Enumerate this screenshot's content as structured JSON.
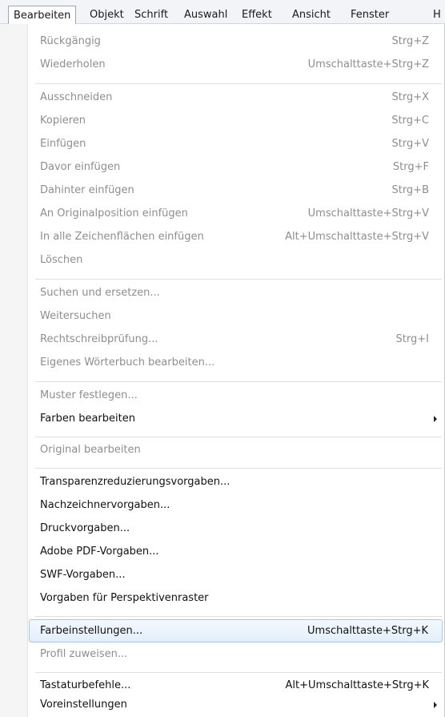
{
  "menubar": {
    "items": [
      "Bearbeiten",
      "Objekt",
      "Schrift",
      "Auswahl",
      "Effekt",
      "Ansicht",
      "Fenster",
      "H"
    ]
  },
  "menu": {
    "items": [
      {
        "label": "Rückgängig",
        "shortcut": "Strg+Z",
        "state": "disabled"
      },
      {
        "label": "Wiederholen",
        "shortcut": "Umschalttaste+Strg+Z",
        "state": "disabled"
      },
      {
        "label": "Ausschneiden",
        "shortcut": "Strg+X",
        "state": "disabled"
      },
      {
        "label": "Kopieren",
        "shortcut": "Strg+C",
        "state": "disabled"
      },
      {
        "label": "Einfügen",
        "shortcut": "Strg+V",
        "state": "disabled"
      },
      {
        "label": "Davor einfügen",
        "shortcut": "Strg+F",
        "state": "disabled"
      },
      {
        "label": "Dahinter einfügen",
        "shortcut": "Strg+B",
        "state": "disabled"
      },
      {
        "label": "An Originalposition einfügen",
        "shortcut": "Umschalttaste+Strg+V",
        "state": "disabled"
      },
      {
        "label": "In alle Zeichenflächen einfügen",
        "shortcut": "Alt+Umschalttaste+Strg+V",
        "state": "disabled"
      },
      {
        "label": "Löschen",
        "shortcut": "",
        "state": "disabled"
      },
      {
        "label": "Suchen und ersetzen...",
        "shortcut": "",
        "state": "disabled"
      },
      {
        "label": "Weitersuchen",
        "shortcut": "",
        "state": "disabled"
      },
      {
        "label": "Rechtschreibprüfung...",
        "shortcut": "Strg+I",
        "state": "disabled"
      },
      {
        "label": "Eigenes Wörterbuch bearbeiten...",
        "shortcut": "",
        "state": "disabled"
      },
      {
        "label": "Muster festlegen...",
        "shortcut": "",
        "state": "disabled"
      },
      {
        "label": "Farben bearbeiten",
        "shortcut": "",
        "state": "enabled",
        "submenu": true
      },
      {
        "label": "Original bearbeiten",
        "shortcut": "",
        "state": "disabled"
      },
      {
        "label": "Transparenzreduzierungsvorgaben...",
        "shortcut": "",
        "state": "enabled"
      },
      {
        "label": "Nachzeichnervorgaben...",
        "shortcut": "",
        "state": "enabled"
      },
      {
        "label": "Druckvorgaben...",
        "shortcut": "",
        "state": "enabled"
      },
      {
        "label": "Adobe PDF-Vorgaben...",
        "shortcut": "",
        "state": "enabled"
      },
      {
        "label": "SWF-Vorgaben...",
        "shortcut": "",
        "state": "enabled"
      },
      {
        "label": "Vorgaben für Perspektivenraster",
        "shortcut": "",
        "state": "enabled"
      },
      {
        "label": "Farbeinstellungen...",
        "shortcut": "Umschalttaste+Strg+K",
        "state": "enabled",
        "highlighted": true
      },
      {
        "label": "Profil zuweisen...",
        "shortcut": "",
        "state": "disabled"
      },
      {
        "label": "Tastaturbefehle...",
        "shortcut": "Alt+Umschalttaste+Strg+K",
        "state": "enabled"
      },
      {
        "label": "Voreinstellungen",
        "shortcut": "",
        "state": "enabled",
        "submenu": true
      }
    ]
  }
}
